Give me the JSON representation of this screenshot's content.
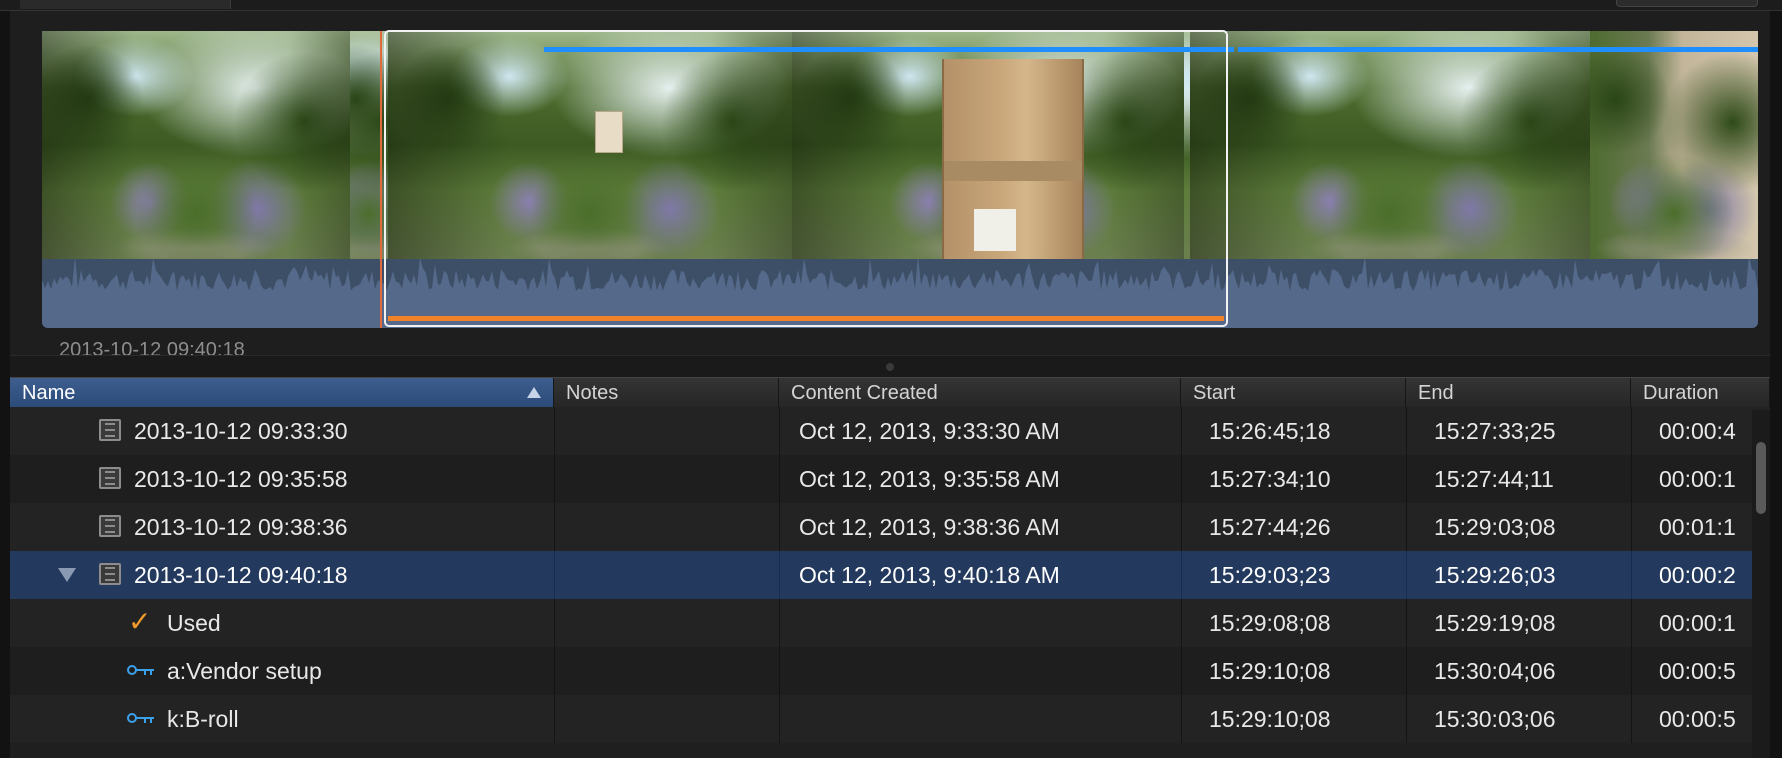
{
  "filmstrip": {
    "clip_caption": "2013-10-12 09:40:18"
  },
  "columns": [
    {
      "key": "name",
      "label": "Name"
    },
    {
      "key": "notes",
      "label": "Notes"
    },
    {
      "key": "content_created",
      "label": "Content Created"
    },
    {
      "key": "start",
      "label": "Start"
    },
    {
      "key": "end",
      "label": "End"
    },
    {
      "key": "duration",
      "label": "Duration"
    }
  ],
  "rows": [
    {
      "type": "clip",
      "name": "2013-10-12 09:33:30",
      "notes": "",
      "content_created": "Oct 12, 2013, 9:33:30 AM",
      "start": "15:26:45;18",
      "end": "15:27:33;25",
      "duration": "00:00:4"
    },
    {
      "type": "clip",
      "name": "2013-10-12 09:35:58",
      "notes": "",
      "content_created": "Oct 12, 2013, 9:35:58 AM",
      "start": "15:27:34;10",
      "end": "15:27:44;11",
      "duration": "00:00:1"
    },
    {
      "type": "clip",
      "name": "2013-10-12 09:38:36",
      "notes": "",
      "content_created": "Oct 12, 2013, 9:38:36 AM",
      "start": "15:27:44;26",
      "end": "15:29:03;08",
      "duration": "00:01:1"
    },
    {
      "type": "clip-expanded",
      "name": "2013-10-12 09:40:18",
      "notes": "",
      "content_created": "Oct 12, 2013, 9:40:18 AM",
      "start": "15:29:03;23",
      "end": "15:29:26;03",
      "duration": "00:00:2",
      "selected": true
    },
    {
      "type": "used",
      "name": "Used",
      "notes": "",
      "content_created": "",
      "start": "15:29:08;08",
      "end": "15:29:19;08",
      "duration": "00:00:1"
    },
    {
      "type": "keyword",
      "name": "a:Vendor setup",
      "notes": "",
      "content_created": "",
      "start": "15:29:10;08",
      "end": "15:30:04;06",
      "duration": "00:00:5"
    },
    {
      "type": "keyword",
      "name": "k:B-roll",
      "notes": "",
      "content_created": "",
      "start": "15:29:10;08",
      "end": "15:30:03;06",
      "duration": "00:00:5"
    }
  ],
  "colors": {
    "selection": "#23395e",
    "playhead": "#e16a3c",
    "range_bar": "#f0832a",
    "keyword_bar": "#1f8fff",
    "used_check": "#f19a2c",
    "keyword_icon": "#3aa0e8"
  }
}
